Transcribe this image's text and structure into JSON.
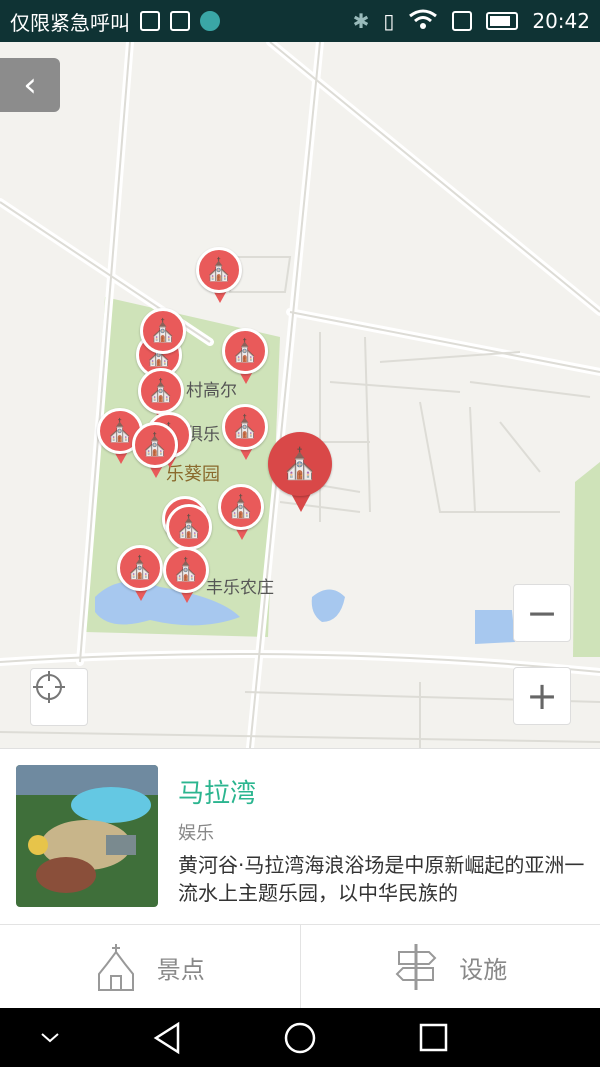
{
  "status_bar": {
    "carrier": "仅限紧急呼叫",
    "time": "20:42",
    "icons": [
      "sim-icon",
      "image-icon",
      "huawei-icon",
      "bluetooth-icon",
      "vibrate-icon",
      "wifi-icon",
      "sim-status-icon",
      "battery-icon"
    ]
  },
  "map": {
    "back_icon": "chevron-left-icon",
    "labels": {
      "label1": "村高尔",
      "label2": "俱乐",
      "label3": "乐葵园",
      "label4": "丰乐农庄"
    },
    "zoom_out": "−",
    "zoom_in": "+",
    "pin_icon": "church-icon",
    "colors": {
      "pin": "#e95a5a",
      "selected_pin": "#d94848",
      "park": "#cfe3b9",
      "water": "#a7c8ef",
      "road": "#ffffff"
    }
  },
  "poi_card": {
    "title": "马拉湾",
    "category": "娱乐",
    "description": "黄河谷·马拉湾海浪浴场是中原新崛起的亚洲一流水上主题乐园，以中华民族的"
  },
  "tabs": [
    {
      "label": "景点",
      "icon": "church-outline-icon"
    },
    {
      "label": "设施",
      "icon": "signpost-icon"
    }
  ],
  "nav": [
    "collapse-icon",
    "back-icon",
    "home-icon",
    "recents-icon"
  ]
}
